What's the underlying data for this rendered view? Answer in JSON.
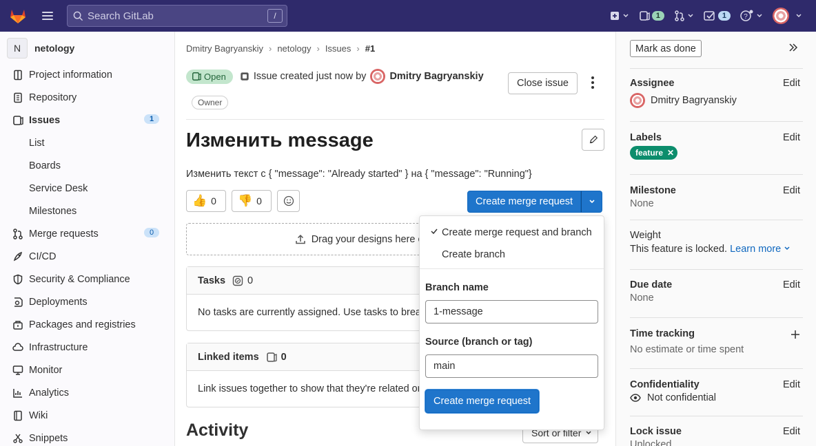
{
  "topbar": {
    "search_placeholder": "Search GitLab",
    "search_shortcut": "/",
    "issues_count": "1",
    "todos_count": "1"
  },
  "sidebar": {
    "project_initial": "N",
    "project_name": "netology",
    "items": [
      {
        "label": "Project information",
        "icon": "info-icon"
      },
      {
        "label": "Repository",
        "icon": "doc-icon"
      },
      {
        "label": "Issues",
        "icon": "issues-icon",
        "count": "1"
      },
      {
        "label": "List"
      },
      {
        "label": "Boards"
      },
      {
        "label": "Service Desk"
      },
      {
        "label": "Milestones"
      },
      {
        "label": "Merge requests",
        "icon": "merge-request-icon",
        "count": "0"
      },
      {
        "label": "CI/CD",
        "icon": "rocket-icon"
      },
      {
        "label": "Security & Compliance",
        "icon": "shield-icon"
      },
      {
        "label": "Deployments",
        "icon": "deployments-icon"
      },
      {
        "label": "Packages and registries",
        "icon": "package-icon"
      },
      {
        "label": "Infrastructure",
        "icon": "cloud-icon"
      },
      {
        "label": "Monitor",
        "icon": "monitor-icon"
      },
      {
        "label": "Analytics",
        "icon": "chart-icon"
      },
      {
        "label": "Wiki",
        "icon": "book-icon"
      },
      {
        "label": "Snippets",
        "icon": "snippet-icon"
      }
    ]
  },
  "breadcrumb": [
    "Dmitry Bagryanskiy",
    "netology",
    "Issues",
    "#1"
  ],
  "issue": {
    "status": "Open",
    "created_text": "Issue created just now by",
    "author": "Dmitry Bagryanskiy",
    "role": "Owner",
    "close_label": "Close issue",
    "title": "Изменить message",
    "description": "Изменить текст с { \"message\": \"Already started\" } на { \"message\": \"Running\"}",
    "thumbs_up": "0",
    "thumbs_down": "0",
    "create_mr_label": "Create merge request",
    "dropzone_text": "Drag your designs here or click to upload.",
    "tasks_title": "Tasks",
    "tasks_count": "0",
    "tasks_empty": "No tasks are currently assigned. Use tasks to break down this issue into smaller parts.",
    "linked_title": "Linked items",
    "linked_count": "0",
    "linked_empty": "Link issues together to show that they're related or that one is blocking others.",
    "activity_title": "Activity",
    "sort_label": "Sort or filter"
  },
  "mr_dropdown": {
    "option_1": "Create merge request and branch",
    "option_2": "Create branch",
    "branch_label": "Branch name",
    "branch_value": "1-message",
    "source_label": "Source (branch or tag)",
    "source_value": "main",
    "submit_label": "Create merge request"
  },
  "right_sidebar": {
    "mark_done": "Mark as done",
    "edit": "Edit",
    "assignee_title": "Assignee",
    "assignee_name": "Dmitry Bagryanskiy",
    "labels_title": "Labels",
    "label_name": "feature",
    "label_color": "#0c8d6c",
    "milestone_title": "Milestone",
    "milestone_value": "None",
    "weight_title": "Weight",
    "weight_text": "This feature is locked.",
    "learn_more": "Learn more",
    "due_title": "Due date",
    "due_value": "None",
    "time_title": "Time tracking",
    "time_value": "No estimate or time spent",
    "conf_title": "Confidentiality",
    "conf_value": "Not confidential",
    "lock_title": "Lock issue",
    "lock_value": "Unlocked"
  },
  "colors": {
    "topbar": "#2f2a6b",
    "primary": "#1f75cb",
    "open_badge": "#c3e6cd"
  }
}
